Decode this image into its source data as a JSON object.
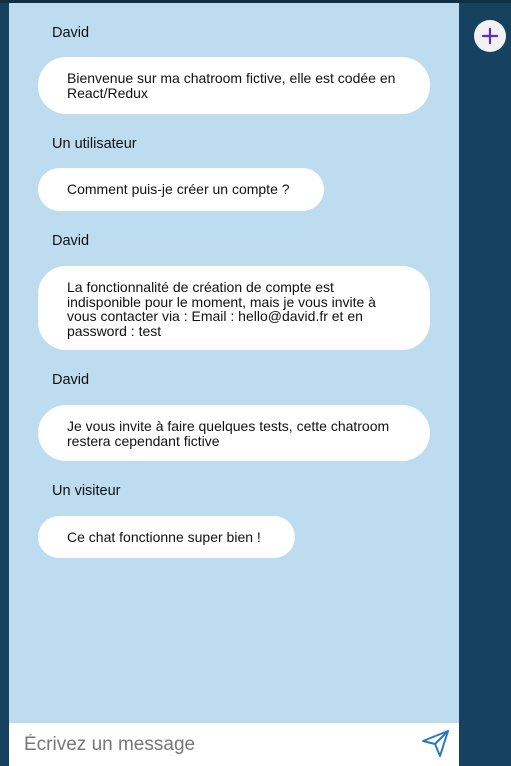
{
  "messages": [
    {
      "author": "David",
      "text": "Bienvenue sur ma chatroom fictive, elle est codée en React/Redux"
    },
    {
      "author": "Un utilisateur",
      "text": "Comment puis-je créer un compte ?"
    },
    {
      "author": "David",
      "text": "La fonctionnalité de création de compte est indisponible pour le moment, mais je vous invite à vous contacter via : Email : hello@david.fr et en password : test"
    },
    {
      "author": "David",
      "text": "Je vous invite à faire quelques tests, cette chatroom restera cependant fictive"
    },
    {
      "author": "Un visiteur",
      "text": "Ce chat fonctionne super bien !"
    }
  ],
  "composer": {
    "placeholder": "Écrivez un message",
    "value": ""
  },
  "icons": {
    "send": "send-icon",
    "add": "plus-icon"
  },
  "colors": {
    "sidebar": "#16425f",
    "chat_background": "#bddcef",
    "bubble": "#ffffff",
    "accent": "#5b2bd6",
    "send_icon": "#2b7bb9"
  }
}
